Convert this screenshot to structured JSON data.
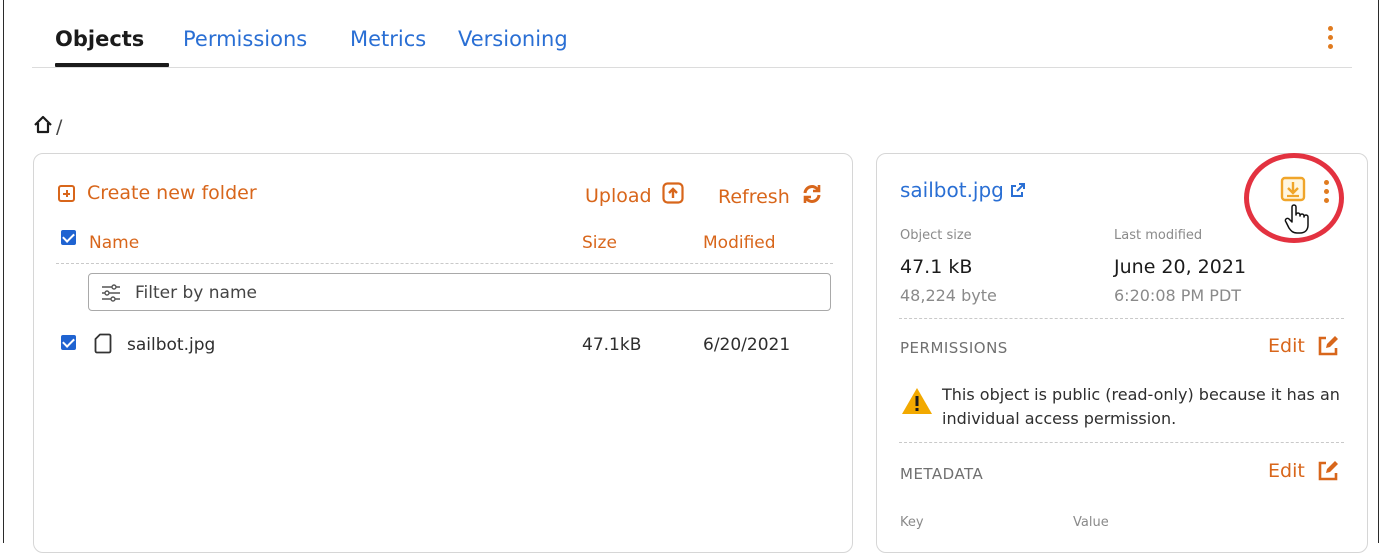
{
  "tabs": [
    {
      "label": "Objects",
      "active": true
    },
    {
      "label": "Permissions",
      "active": false
    },
    {
      "label": "Metrics",
      "active": false
    },
    {
      "label": "Versioning",
      "active": false
    }
  ],
  "breadcrumb": {
    "separator": "/"
  },
  "browser": {
    "create_folder_label": "Create new folder",
    "upload_label": "Upload",
    "refresh_label": "Refresh",
    "columns": {
      "name": "Name",
      "size": "Size",
      "modified": "Modified"
    },
    "filter_placeholder": "Filter by name",
    "rows": [
      {
        "name": "sailbot.jpg",
        "size": "47.1kB",
        "modified": "6/20/2021",
        "checked": true
      }
    ]
  },
  "details": {
    "title": "sailbot.jpg",
    "object_size_label": "Object size",
    "object_size": "47.1 kB",
    "object_size_bytes": "48,224 byte",
    "last_modified_label": "Last modified",
    "last_modified_date": "June 20, 2021",
    "last_modified_time": "6:20:08 PM PDT",
    "permissions_label": "PERMISSIONS",
    "permissions_edit": "Edit",
    "permission_warning": "This object is public (read-only) because it has an individual access permission.",
    "metadata_label": "METADATA",
    "metadata_edit": "Edit",
    "metadata_key_label": "Key",
    "metadata_value_label": "Value"
  },
  "colors": {
    "accent": "#d8661b",
    "link": "#2a6fd4",
    "checkbox": "#1f63d1",
    "highlight": "#e33240",
    "warning": "#f2a900"
  }
}
